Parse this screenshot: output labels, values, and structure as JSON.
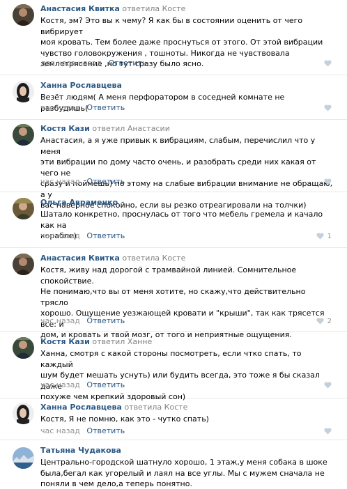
{
  "comments": [
    {
      "author": "Анастасия Квитка",
      "replied_verb": "ответила",
      "reply_to": "Косте",
      "text": "Костя, эм? Это вы к чему? Я как бы в состоянии оценить от чего вибрирует\nмоя кровать. Тем более даже проснуться от этого. От этой вибрации\nчувство головокружения , тошноты. Никогда не чувствовала\nземлетрясение ,но тут сразу было ясно.",
      "time": "два часа назад",
      "reply_label": "Ответить",
      "likes": ""
    },
    {
      "author": "Ханна Рославцева",
      "replied_verb": "",
      "reply_to": "",
      "text": "Везёт людям( А меня перфоратором в соседней комнате не разбудишь(",
      "time": "час назад",
      "reply_label": "Ответить",
      "likes": ""
    },
    {
      "author": "Костя Кази",
      "replied_verb": "ответил",
      "reply_to": "Анастасии",
      "text": "Анастасия, а я уже привык к вибрациям, слабым, перечислил что у меня\nэти вибрации по дому часто очень, и разобрать среди них какая от чего не\nсразу и поймешь) по этому на слабые вибрации внимание не обращаю, а у\nвас наверное спокойно, если вы резко отреагировали на толчки)",
      "time": "час назад",
      "reply_label": "Ответить",
      "likes": ""
    },
    {
      "author": "Ольга Авраменко",
      "replied_verb": "",
      "reply_to": "",
      "text": "Шатало конкретно, проснулась от того что мебель гремела и качало как на\nкорабле)",
      "time": "час назад",
      "reply_label": "Ответить",
      "likes": "1"
    },
    {
      "author": "Анастасия Квитка",
      "replied_verb": "ответила",
      "reply_to": "Косте",
      "text": "Костя, живу над дорогой с трамвайной линией. Сомнительное\nспокойствие.\nНе понимаю,что вы от меня хотите, но скажу,что действительно трясло\nхорошо. Ощущение уезжающей кровати и \"крыши\", так как трясется все: и\nдом, и кровать и твой мозг, от того и неприятные ощущения.",
      "time": "час назад",
      "reply_label": "Ответить",
      "likes": "2"
    },
    {
      "author": "Костя Кази",
      "replied_verb": "ответил",
      "reply_to": "Ханне",
      "text": "Ханна, смотря с какой стороны посмотреть, если чтко спать, то каждый\nшум будет мешать уснуть) или будить всегда, это тоже я бы сказал даже\nпохуже чем крепкий здоровый сон)",
      "time": "час назад",
      "reply_label": "Ответить",
      "likes": ""
    },
    {
      "author": "Ханна Рославцева",
      "replied_verb": "ответила",
      "reply_to": "Косте",
      "text": "Костя, Я не помню, как это - чутко спать)",
      "time": "час назад",
      "reply_label": "Ответить",
      "likes": ""
    },
    {
      "author": "Татьяна Чудакова",
      "replied_verb": "",
      "reply_to": "",
      "text": "Центрально-городской шатнуло хорошо, 1 этаж,у меня собака в шоке\nбыла,бегал как угорелый и лаял на все углы. Мы с мужем сначала не\nпоняли в чем дело,а теперь понятно.",
      "time": "",
      "reply_label": "",
      "likes": ""
    }
  ],
  "colors": {
    "author_link": "#2a5885",
    "muted": "#939393",
    "divider": "#e7e8ec"
  },
  "icons": {
    "like": "heart-icon"
  }
}
